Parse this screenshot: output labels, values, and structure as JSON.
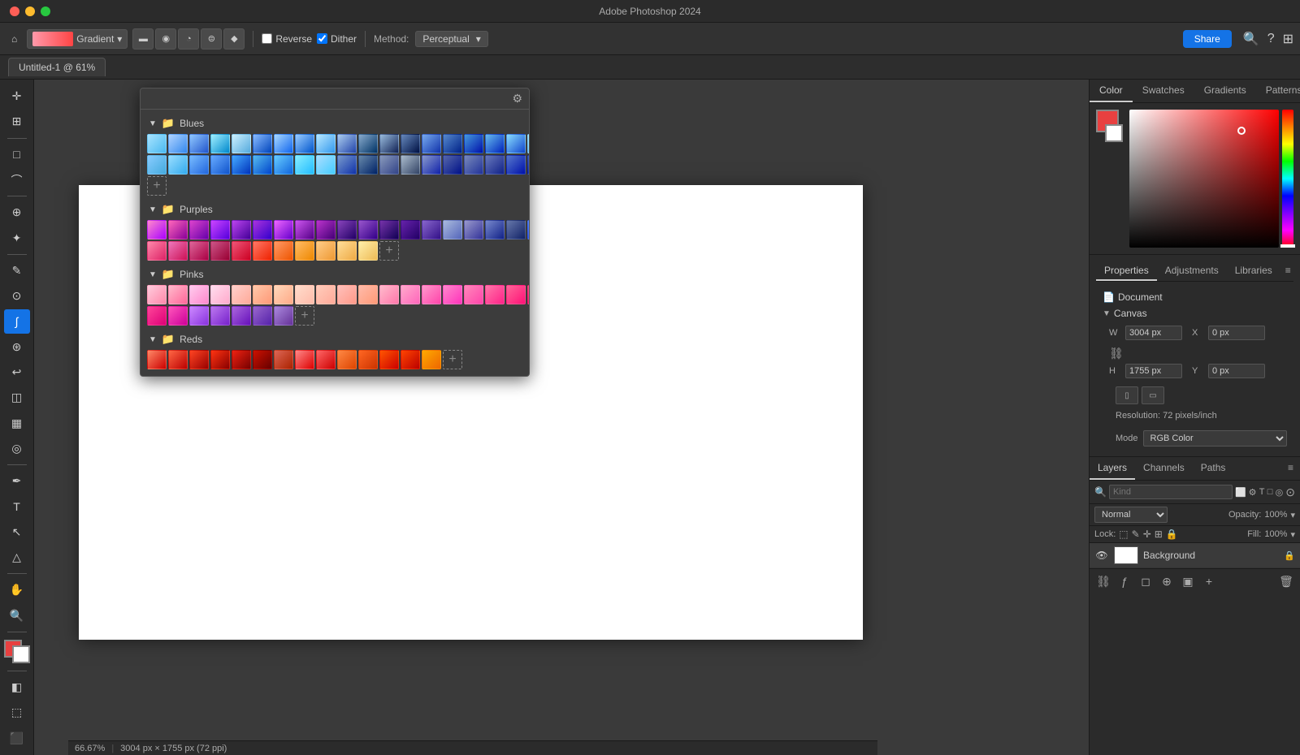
{
  "titlebar": {
    "title": "Adobe Photoshop 2024"
  },
  "toolbar": {
    "gradient_label": "Gradient",
    "reverse_label": "Reverse",
    "dither_label": "Dither",
    "method_label": "Method:",
    "method_value": "Perceptual",
    "share_label": "Share"
  },
  "tab": {
    "label": "Untitled-1 @ 61%"
  },
  "gradient_popup": {
    "settings_icon": "⚙",
    "sections": [
      {
        "id": "blues",
        "label": "Blues",
        "expanded": true,
        "gradients": [
          {
            "colors": [
              "#a8e4ff",
              "#4ab8f0"
            ]
          },
          {
            "colors": [
              "#b0d4ff",
              "#3388ee"
            ]
          },
          {
            "colors": [
              "#90c8ff",
              "#2255cc"
            ]
          },
          {
            "colors": [
              "#a0f0ff",
              "#0088cc"
            ]
          },
          {
            "colors": [
              "#ccf0ff",
              "#55aadd"
            ]
          },
          {
            "colors": [
              "#88bbff",
              "#0044bb"
            ]
          },
          {
            "colors": [
              "#a8d8ff",
              "#1166ee"
            ]
          },
          {
            "colors": [
              "#99ccff",
              "#0055cc"
            ]
          },
          {
            "colors": [
              "#b8e8ff",
              "#3399ee"
            ]
          },
          {
            "colors": [
              "#aaccee",
              "#2244aa"
            ]
          },
          {
            "colors": [
              "#88aacc",
              "#003366"
            ]
          },
          {
            "colors": [
              "#99bbdd",
              "#112255"
            ]
          },
          {
            "colors": [
              "#6688bb",
              "#001144"
            ]
          },
          {
            "colors": [
              "#77aaee",
              "#1133aa"
            ]
          },
          {
            "colors": [
              "#5588cc",
              "#002288"
            ]
          },
          {
            "colors": [
              "#4499dd",
              "#0011aa"
            ]
          },
          {
            "colors": [
              "#66bbee",
              "#0022bb"
            ]
          },
          {
            "colors": [
              "#88ddff",
              "#1144cc"
            ]
          },
          {
            "colors": [
              "#aaeeff",
              "#55aaee"
            ]
          },
          {
            "colors": [
              "#88ccff",
              "#44aadd"
            ]
          },
          {
            "colors": [
              "#99ddff",
              "#33aaee"
            ]
          },
          {
            "colors": [
              "#77bbff",
              "#2266dd"
            ]
          },
          {
            "colors": [
              "#66aaff",
              "#1155cc"
            ]
          },
          {
            "colors": [
              "#44aaff",
              "#0033bb"
            ]
          },
          {
            "colors": [
              "#55bbee",
              "#0044cc"
            ]
          },
          {
            "colors": [
              "#66ccff",
              "#1166dd"
            ]
          },
          {
            "colors": [
              "#88eeff",
              "#22bbff"
            ]
          },
          {
            "colors": [
              "#aaddff",
              "#44ccff"
            ]
          },
          {
            "colors": [
              "#7799cc",
              "#1133aa"
            ]
          },
          {
            "colors": [
              "#6688aa",
              "#002266"
            ]
          },
          {
            "colors": [
              "#8899bb",
              "#334488"
            ]
          },
          {
            "colors": [
              "#aabbcc",
              "#334466"
            ]
          },
          {
            "colors": [
              "#8899cc",
              "#1122aa"
            ]
          },
          {
            "colors": [
              "#5566aa",
              "#001188"
            ]
          },
          {
            "colors": [
              "#7788bb",
              "#223399"
            ]
          },
          {
            "colors": [
              "#6677bb",
              "#112288"
            ]
          },
          {
            "colors": [
              "#5577cc",
              "#0011aa"
            ]
          },
          {
            "colors": [
              "#4466bb",
              "#001199"
            ]
          }
        ]
      },
      {
        "id": "purples",
        "label": "Purples",
        "expanded": true,
        "gradients": [
          {
            "colors": [
              "#ff88cc",
              "#aa00ff"
            ]
          },
          {
            "colors": [
              "#ff66bb",
              "#880099"
            ]
          },
          {
            "colors": [
              "#dd44cc",
              "#6600aa"
            ]
          },
          {
            "colors": [
              "#cc44ff",
              "#5500dd"
            ]
          },
          {
            "colors": [
              "#bb44ee",
              "#440099"
            ]
          },
          {
            "colors": [
              "#aa33dd",
              "#3300cc"
            ]
          },
          {
            "colors": [
              "#ee66ff",
              "#6600cc"
            ]
          },
          {
            "colors": [
              "#cc55ee",
              "#550088"
            ]
          },
          {
            "colors": [
              "#bb33cc",
              "#440077"
            ]
          },
          {
            "colors": [
              "#8844bb",
              "#220066"
            ]
          },
          {
            "colors": [
              "#9955cc",
              "#330088"
            ]
          },
          {
            "colors": [
              "#7733aa",
              "#110055"
            ]
          },
          {
            "colors": [
              "#6622aa",
              "#220066"
            ]
          },
          {
            "colors": [
              "#8866cc",
              "#331188"
            ]
          },
          {
            "colors": [
              "#aabbdd",
              "#5566bb"
            ]
          },
          {
            "colors": [
              "#9999cc",
              "#333399"
            ]
          },
          {
            "colors": [
              "#7788cc",
              "#112288"
            ]
          },
          {
            "colors": [
              "#6677aa",
              "#112266"
            ]
          },
          {
            "colors": [
              "#5588ff",
              "#2244dd"
            ]
          },
          {
            "colors": [
              "#ff88aa",
              "#dd2266"
            ]
          },
          {
            "colors": [
              "#ee77bb",
              "#cc1155"
            ]
          },
          {
            "colors": [
              "#dd6699",
              "#aa0044"
            ]
          },
          {
            "colors": [
              "#cc5588",
              "#990033"
            ]
          },
          {
            "colors": [
              "#ee5577",
              "#cc0022"
            ]
          },
          {
            "colors": [
              "#ff7766",
              "#ee2200"
            ]
          },
          {
            "colors": [
              "#ff9966",
              "#ee5500"
            ]
          },
          {
            "colors": [
              "#ffbb66",
              "#ee8800"
            ]
          },
          {
            "colors": [
              "#ffcc88",
              "#ee9933"
            ]
          },
          {
            "colors": [
              "#ffdd99",
              "#eeaa44"
            ]
          },
          {
            "colors": [
              "#ffeeaa",
              "#eebb55"
            ]
          }
        ]
      },
      {
        "id": "pinks",
        "label": "Pinks",
        "expanded": true,
        "gradients": [
          {
            "colors": [
              "#ffccdd",
              "#ff88aa"
            ]
          },
          {
            "colors": [
              "#ffbbcc",
              "#ff6699"
            ]
          },
          {
            "colors": [
              "#ffccee",
              "#ff88cc"
            ]
          },
          {
            "colors": [
              "#ffddee",
              "#ffaacc"
            ]
          },
          {
            "colors": [
              "#ffd0cc",
              "#ffaa99"
            ]
          },
          {
            "colors": [
              "#ffc8aa",
              "#ff9977"
            ]
          },
          {
            "colors": [
              "#ffd8bb",
              "#ffaa88"
            ]
          },
          {
            "colors": [
              "#ffddcc",
              "#ffbbaa"
            ]
          },
          {
            "colors": [
              "#ffccbb",
              "#ffaa99"
            ]
          },
          {
            "colors": [
              "#ffc0bb",
              "#ff9988"
            ]
          },
          {
            "colors": [
              "#ffbbaa",
              "#ff9977"
            ]
          },
          {
            "colors": [
              "#ffbbcc",
              "#ff77aa"
            ]
          },
          {
            "colors": [
              "#ffaacc",
              "#ff66bb"
            ]
          },
          {
            "colors": [
              "#ff99cc",
              "#ff44aa"
            ]
          },
          {
            "colors": [
              "#ff88cc",
              "#ff33bb"
            ]
          },
          {
            "colors": [
              "#ff88bb",
              "#ff44aa"
            ]
          },
          {
            "colors": [
              "#ff77aa",
              "#ff2288"
            ]
          },
          {
            "colors": [
              "#ff6699",
              "#ff1177"
            ]
          },
          {
            "colors": [
              "#ff5588",
              "#ee0066"
            ]
          },
          {
            "colors": [
              "#ff4499",
              "#dd0077"
            ]
          },
          {
            "colors": [
              "#ff55bb",
              "#cc0099"
            ]
          },
          {
            "colors": [
              "#cc88ff",
              "#8833dd"
            ]
          },
          {
            "colors": [
              "#bb77ee",
              "#7722cc"
            ]
          },
          {
            "colors": [
              "#aa66dd",
              "#6611bb"
            ]
          },
          {
            "colors": [
              "#9966cc",
              "#5522aa"
            ]
          },
          {
            "colors": [
              "#aa88dd",
              "#663399"
            ]
          }
        ]
      },
      {
        "id": "reds",
        "label": "Reds",
        "expanded": true,
        "gradients": [
          {
            "colors": [
              "#ff8866",
              "#cc0000"
            ]
          },
          {
            "colors": [
              "#ff6644",
              "#bb0000"
            ]
          },
          {
            "colors": [
              "#ff4422",
              "#990000"
            ]
          },
          {
            "colors": [
              "#ff3311",
              "#880000"
            ]
          },
          {
            "colors": [
              "#ee2211",
              "#770000"
            ]
          },
          {
            "colors": [
              "#cc1100",
              "#660000"
            ]
          },
          {
            "colors": [
              "#dd6655",
              "#aa2200"
            ]
          },
          {
            "colors": [
              "#ff8888",
              "#dd0000"
            ]
          },
          {
            "colors": [
              "#ff6666",
              "#cc0000"
            ]
          },
          {
            "colors": [
              "#ff8844",
              "#dd4400"
            ]
          },
          {
            "colors": [
              "#ff6622",
              "#cc3300"
            ]
          },
          {
            "colors": [
              "#ff5500",
              "#cc0000"
            ]
          },
          {
            "colors": [
              "#ff4400",
              "#bb0000"
            ]
          },
          {
            "colors": [
              "#ffaa00",
              "#ee6600"
            ]
          }
        ]
      }
    ]
  },
  "right_panel": {
    "color_tabs": [
      "Color",
      "Swatches",
      "Gradients",
      "Patterns"
    ],
    "active_color_tab": "Color",
    "properties_tabs": [
      "Properties",
      "Adjustments",
      "Libraries"
    ],
    "active_properties_tab": "Properties",
    "document_label": "Document",
    "canvas_label": "Canvas",
    "width_label": "W",
    "height_label": "H",
    "width_value": "3004 px",
    "height_value": "1755 px",
    "x_label": "X",
    "y_label": "Y",
    "x_value": "0 px",
    "y_value": "0 px",
    "resolution_text": "Resolution: 72 pixels/inch",
    "mode_label": "Mode",
    "mode_value": "RGB Color",
    "layers_tabs": [
      "Layers",
      "Channels",
      "Paths"
    ],
    "active_layers_tab": "Layers",
    "kind_placeholder": "Kind",
    "blend_mode": "Normal",
    "opacity_label": "Opacity:",
    "opacity_value": "100%",
    "lock_label": "Lock:",
    "fill_label": "Fill:",
    "fill_value": "100%",
    "layer_name": "Background"
  },
  "bottom_bar": {
    "zoom": "66.67%",
    "dimensions": "3004 px × 1755 px (72 ppi)"
  },
  "icons": {
    "home": "⌂",
    "move": "✛",
    "select_rect": "□",
    "lasso": "⌒",
    "transform": "⊕",
    "eyedropper": "✎",
    "healing": "⊙",
    "brush": "∫",
    "clone": "⊛",
    "eraser": "◫",
    "gradient": "▦",
    "blur": "◎",
    "pen": "✒",
    "text": "T",
    "shape": "△",
    "hand": "✋",
    "zoom_tool": "🔍",
    "eye": "👁"
  }
}
